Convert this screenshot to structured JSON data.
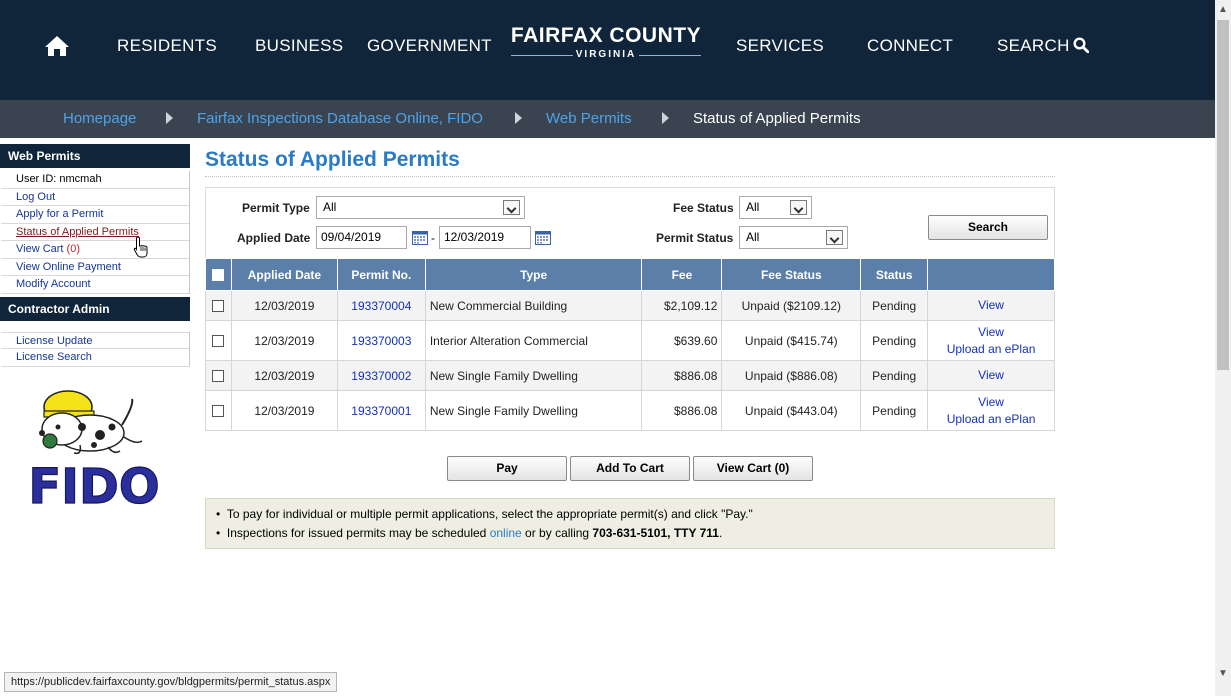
{
  "nav": {
    "items": [
      "RESIDENTS",
      "BUSINESS",
      "GOVERNMENT",
      "SERVICES",
      "CONNECT",
      "SEARCH"
    ],
    "logo_main": "FAIRFAX COUNTY",
    "logo_sub": "VIRGINIA",
    "home_icon": "home-icon",
    "search_icon": "magnifier-icon"
  },
  "breadcrumb": [
    "Homepage",
    "Fairfax Inspections Database Online, FIDO",
    "Web Permits",
    "Status of Applied Permits"
  ],
  "sidebar": {
    "header1": "Web Permits",
    "user": "User ID: nmcmah",
    "links": [
      "Log Out",
      "Apply for a Permit",
      "Status of Applied Permits"
    ],
    "cart_label": "View Cart",
    "cart_count": "(0)",
    "links2": [
      "View Online Payment",
      "Modify Account"
    ],
    "header2": "Contractor Admin",
    "admin_links": [
      "License Update",
      "License Search"
    ],
    "logo_text": "FIDO"
  },
  "main": {
    "title": "Status of Applied Permits",
    "filters": {
      "permit_type_label": "Permit Type",
      "permit_type_value": "All",
      "applied_date_label": "Applied Date",
      "date_from": "09/04/2019",
      "date_sep": "-",
      "date_to": "12/03/2019",
      "fee_status_label": "Fee Status",
      "fee_status_value": "All",
      "permit_status_label": "Permit Status",
      "permit_status_value": "All",
      "search_button": "Search"
    },
    "table": {
      "headers": [
        "Applied Date",
        "Permit No.",
        "Type",
        "Fee",
        "Fee Status",
        "Status"
      ],
      "rows": [
        {
          "date": "12/03/2019",
          "permit": "193370004",
          "type": "New Commercial Building",
          "fee": "$2,109.12",
          "fee_status": "Unpaid ($2109.12)",
          "status": "Pending",
          "view": "View",
          "upload": ""
        },
        {
          "date": "12/03/2019",
          "permit": "193370003",
          "type": "Interior Alteration Commercial",
          "fee": "$639.60",
          "fee_status": "Unpaid ($415.74)",
          "status": "Pending",
          "view": "View",
          "upload": "Upload an ePlan"
        },
        {
          "date": "12/03/2019",
          "permit": "193370002",
          "type": "New Single Family Dwelling",
          "fee": "$886.08",
          "fee_status": "Unpaid ($886.08)",
          "status": "Pending",
          "view": "View",
          "upload": ""
        },
        {
          "date": "12/03/2019",
          "permit": "193370001",
          "type": "New Single Family Dwelling",
          "fee": "$886.08",
          "fee_status": "Unpaid ($443.04)",
          "status": "Pending",
          "view": "View",
          "upload": "Upload an ePlan"
        }
      ]
    },
    "buttons": {
      "pay": "Pay",
      "add_to_cart": "Add To Cart",
      "view_cart": "View Cart (0)"
    },
    "notes": {
      "note1": "To pay for individual or multiple permit applications, select the appropriate permit(s) and click \"Pay.\"",
      "note2_a": "Inspections for issued permits may be scheduled ",
      "note2_link": "online",
      "note2_b": " or by calling ",
      "note2_phone": "703-631-5101, TTY 711",
      "note2_end": "."
    }
  },
  "statusbar": "https://publicdev.fairfaxcounty.gov/bldgpermits/permit_status.aspx",
  "colors": {
    "nav_bg": "#10243a",
    "breadcrumb_bg": "#3a4451",
    "title_blue": "#2b7bc4",
    "table_header": "#5b7fa8",
    "link_blue": "#1530b8"
  }
}
